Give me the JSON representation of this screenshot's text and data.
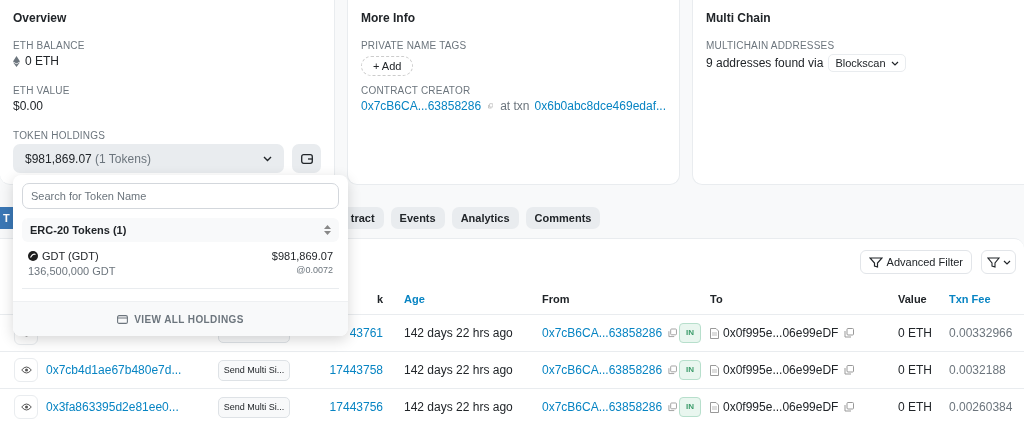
{
  "overview": {
    "title": "Overview",
    "eth_balance": {
      "label": "ETH BALANCE",
      "value": "0 ETH"
    },
    "eth_value": {
      "label": "ETH VALUE",
      "value": "$0.00"
    },
    "token_holdings": {
      "label": "TOKEN HOLDINGS",
      "value": "$981,869.07",
      "count": "(1 Tokens)",
      "expanded": true
    }
  },
  "more_info": {
    "title": "More Info",
    "name_tags": {
      "label": "PRIVATE NAME TAGS",
      "add": "+ Add"
    },
    "creator": {
      "label": "CONTRACT CREATOR",
      "address": "0x7cB6CA...63858286",
      "at_txn": "at txn",
      "txn": "0x6b0abc8dce469edaf..."
    }
  },
  "multi_chain": {
    "title": "Multi Chain",
    "label": "MULTICHAIN ADDRESSES",
    "found": "9 addresses found via",
    "source": "Blockscan"
  },
  "token_dropdown": {
    "search": {
      "placeholder": "Search for Token Name"
    },
    "section": "ERC-20 Tokens (1)",
    "tokens": [
      {
        "name": "GDT (GDT)",
        "amount": "136,500,000 GDT",
        "value": "$981,869.07",
        "rate": "@0.0072"
      }
    ],
    "footer": "VIEW ALL HOLDINGS"
  },
  "tabs": [
    {
      "label": "T",
      "selected": true
    },
    {
      "label": "tract",
      "selected": false
    },
    {
      "label": "Events",
      "selected": false
    },
    {
      "label": "Analytics",
      "selected": false
    },
    {
      "label": "Comments",
      "selected": false
    }
  ],
  "filter": {
    "advanced": "Advanced Filter"
  },
  "table": {
    "header": {
      "block": {
        "label": "k",
        "link": false
      },
      "age": {
        "label": "Age",
        "link": true
      },
      "from": {
        "label": "From",
        "link": false
      },
      "to": {
        "label": "To",
        "link": false
      },
      "value": {
        "label": "Value",
        "link": false
      },
      "fee": {
        "label": "Txn Fee",
        "link": true
      }
    },
    "rows": [
      {
        "block": "43761",
        "age": "142 days 22 hrs ago",
        "from": "0x7cB6CA...63858286",
        "direction": "IN",
        "to": "0x0f995e...06e99eDF",
        "value": "0 ETH",
        "fee": "0.00332966"
      },
      {
        "hash": "0x7cb4d1ae67b480e7d...",
        "method": "Send Multi Si...",
        "block": "17443758",
        "age": "142 days 22 hrs ago",
        "from": "0x7cB6CA...63858286",
        "direction": "IN",
        "to": "0x0f995e...06e99eDF",
        "value": "0 ETH",
        "fee": "0.0032188"
      },
      {
        "hash": "0x3fa863395d2e81ee0...",
        "method": "Send Multi Si...",
        "block": "17443756",
        "age": "142 days 22 hrs ago",
        "from": "0x7cB6CA...63858286",
        "direction": "IN",
        "to": "0x0f995e...06e99eDF",
        "value": "0 ETH",
        "fee": "0.00260384"
      }
    ]
  }
}
